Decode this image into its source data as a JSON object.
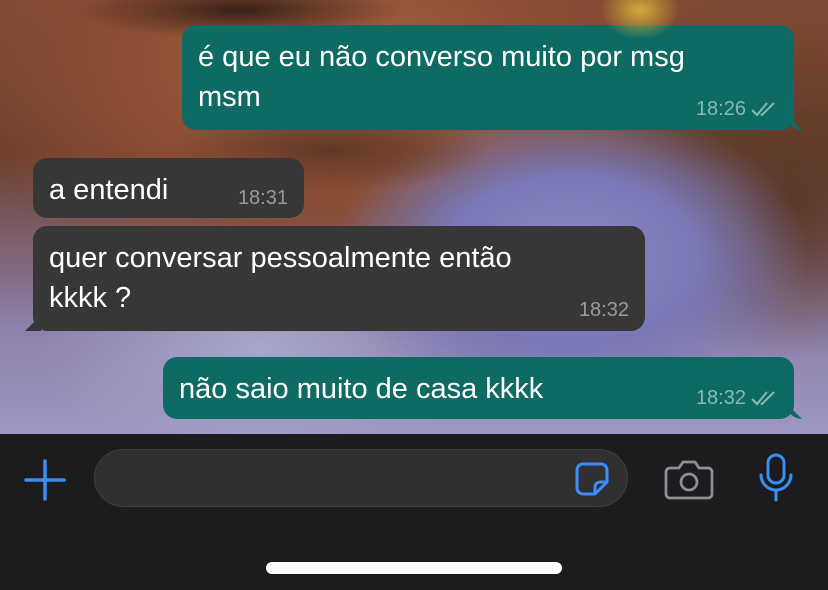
{
  "messages": [
    {
      "direction": "outgoing",
      "text": "é que eu não converso muito por msg\nmsm",
      "time": "18:26",
      "read": true
    },
    {
      "direction": "incoming",
      "text": "a entendi",
      "time": "18:31"
    },
    {
      "direction": "incoming",
      "text": "quer conversar pessoalmente então\nkkkk ?",
      "time": "18:32"
    },
    {
      "direction": "outgoing",
      "text": "não saio muito de casa kkkk",
      "time": "18:32",
      "read": true
    }
  ],
  "composer": {
    "placeholder": "",
    "icons": [
      "plus-icon",
      "sticker-icon",
      "camera-icon",
      "microphone-icon"
    ]
  },
  "colors": {
    "outgoing_bubble": "#0d6b63",
    "incoming_bubble": "#373738",
    "accent": "#3a8ef6",
    "composer_bg": "#1c1c1e"
  }
}
